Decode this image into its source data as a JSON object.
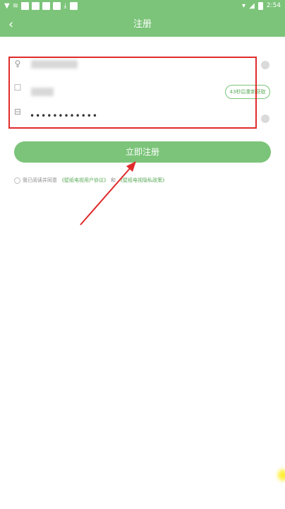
{
  "status_bar": {
    "time": "2:54",
    "left_icons": [
      "signal-icon",
      "wifi-icon",
      "app-icon",
      "app-icon",
      "app-icon",
      "app-icon",
      "download-icon",
      "app-icon"
    ],
    "right_icons": [
      "wifi-icon",
      "signal-icon",
      "battery-icon"
    ]
  },
  "nav": {
    "title": "注册",
    "back_icon": "chevron-left-icon"
  },
  "form": {
    "phone": {
      "icon": "user-icon",
      "value": ""
    },
    "code": {
      "icon": "sms-icon",
      "value": "",
      "button_label": "43秒后重新获取"
    },
    "password": {
      "icon": "lock-icon",
      "value": "••••••••••••"
    }
  },
  "register_button": {
    "label": "立即注册"
  },
  "agreement": {
    "prefix": "我已阅读并同意",
    "user_agreement": "《壁纸电视用户协议》",
    "conjunction": "和",
    "privacy_policy": "《壁纸电视隐私政策》"
  },
  "colors": {
    "primary": "#7cc47a",
    "highlight": "#e02b2b",
    "link": "#5aaa58"
  }
}
